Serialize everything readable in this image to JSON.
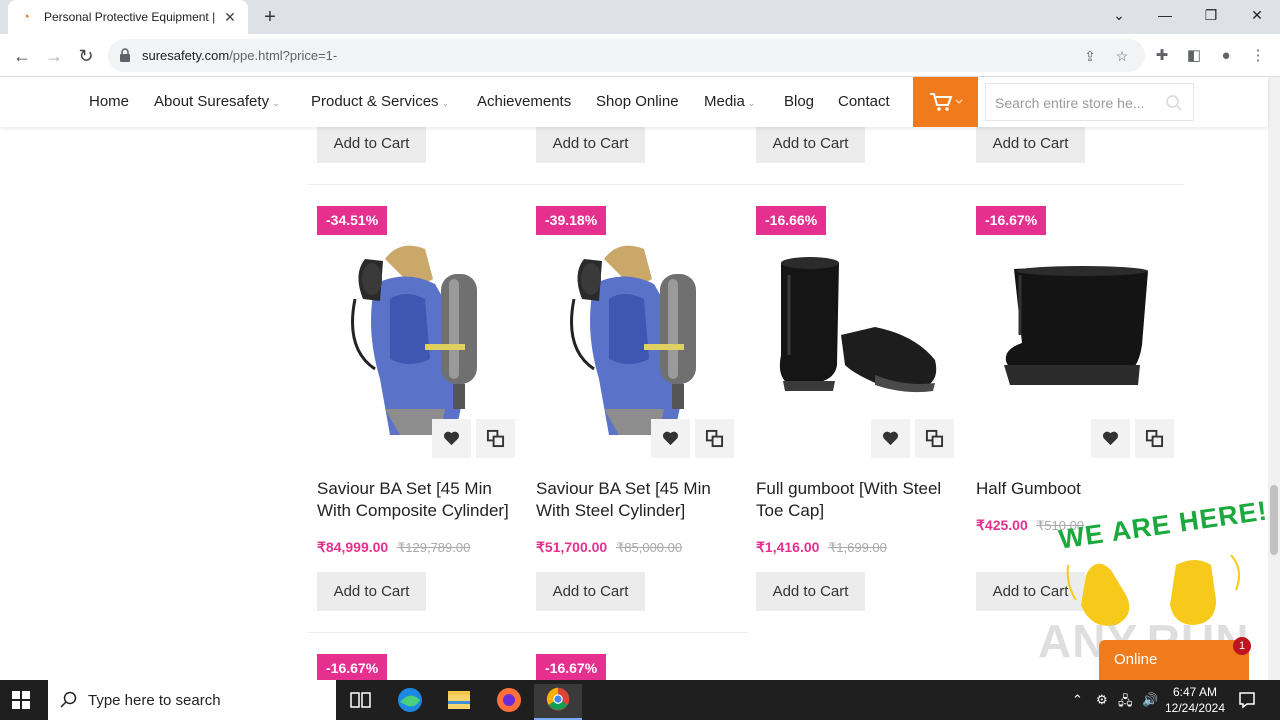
{
  "browser": {
    "tab_title": "Personal Protective Equipment |",
    "tab_close": "✕",
    "new_tab": "+",
    "url_host": "suresafety.com",
    "url_path": "/ppe.html?price=1-"
  },
  "nav": {
    "items": [
      {
        "label": "Home",
        "has_caret": false
      },
      {
        "label": "About Suresafety",
        "has_caret": true
      },
      {
        "label": "Product & Services",
        "has_caret": true
      },
      {
        "label": "Achievements",
        "has_caret": false
      },
      {
        "label": "Shop Online",
        "has_caret": false
      },
      {
        "label": "Media",
        "has_caret": true
      },
      {
        "label": "Blog",
        "has_caret": false
      },
      {
        "label": "Contact",
        "has_caret": false
      }
    ],
    "search_placeholder": "Search entire store he...",
    "cart_color": "#f07b1d"
  },
  "products": {
    "add_to_cart_label": "Add to Cart",
    "row": [
      {
        "discount": "-34.51%",
        "name": "Saviour BA Set [45 Min With Composite Cylinder]",
        "price": "₹84,999.00",
        "old_price": "₹129,789.00",
        "image": "breathing-apparatus"
      },
      {
        "discount": "-39.18%",
        "name": "Saviour BA Set [45 Min With Steel Cylinder]",
        "price": "₹51,700.00",
        "old_price": "₹85,000.00",
        "image": "breathing-apparatus"
      },
      {
        "discount": "-16.66%",
        "name": "Full gumboot [With Steel Toe Cap]",
        "price": "₹1,416.00",
        "old_price": "₹1,699.00",
        "image": "full-gumboot"
      },
      {
        "discount": "-16.67%",
        "name": "Half Gumboot",
        "price": "₹425.00",
        "old_price": "₹510.00",
        "image": "half-gumboot"
      }
    ],
    "next_row_discounts": [
      "-16.67%",
      "-16.67%"
    ],
    "accent_color": "#e5308f"
  },
  "overlay": {
    "we_are_here": "WE ARE HERE!",
    "watermark": "ANY.RUN",
    "chat_label": "Online",
    "chat_notifications": "1"
  },
  "taskbar": {
    "search_label": "Type here to search",
    "time": "6:47 AM",
    "date": "12/24/2024"
  }
}
